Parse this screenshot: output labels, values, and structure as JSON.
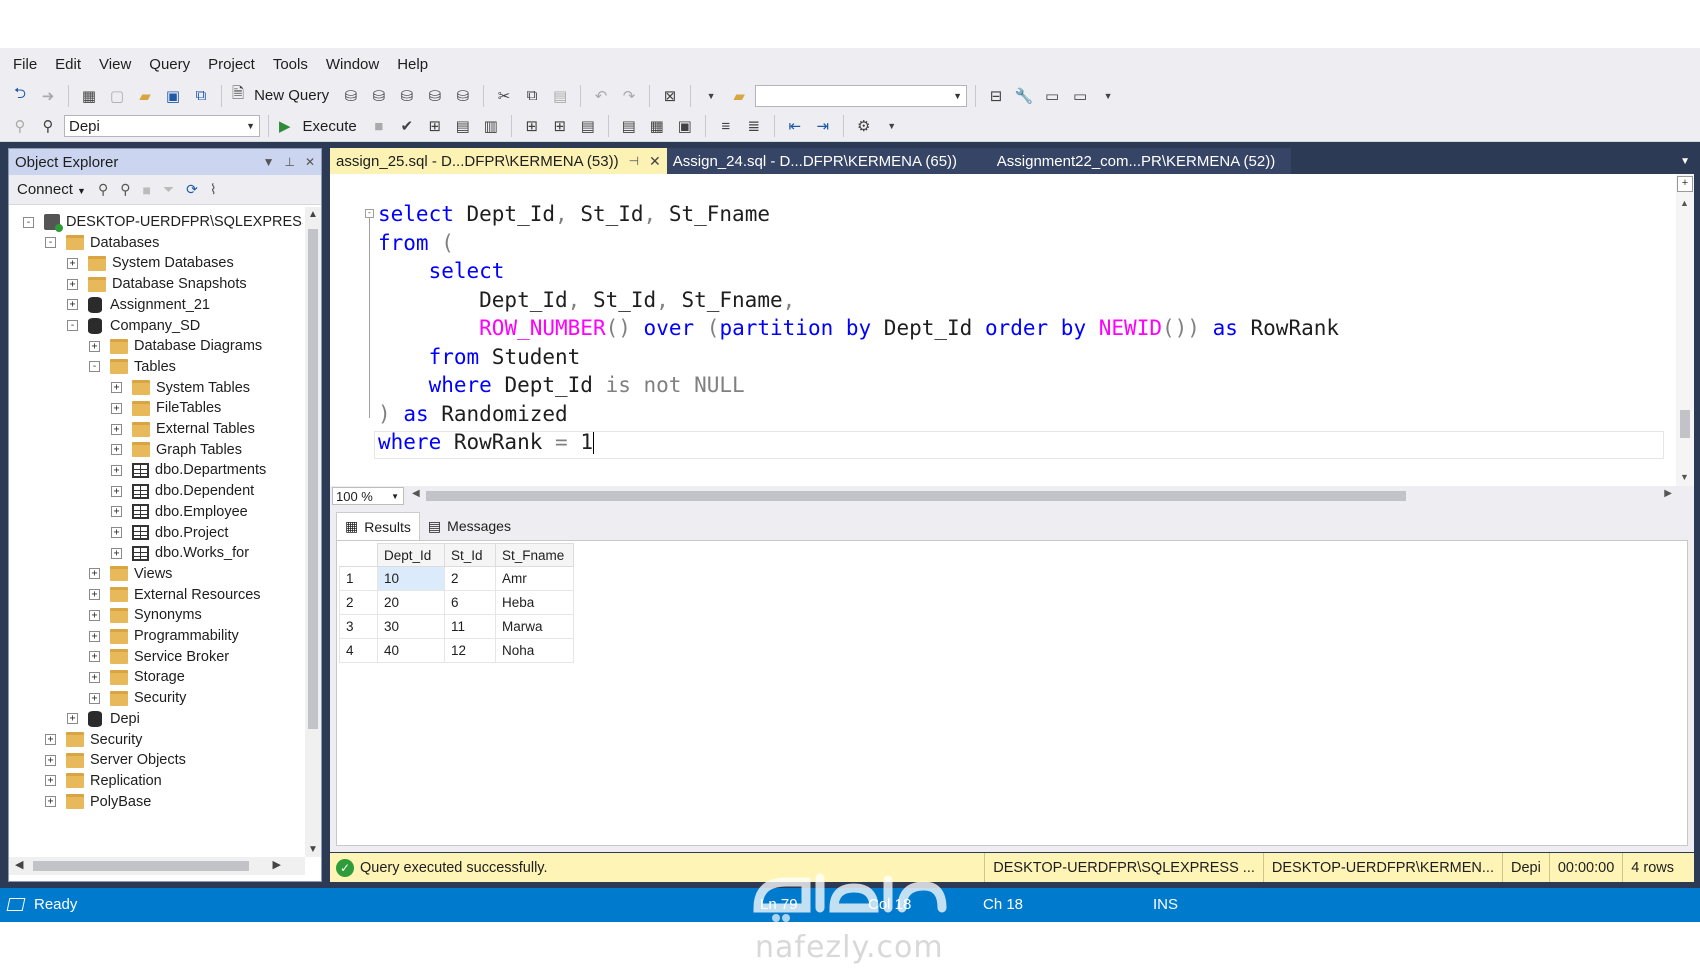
{
  "menu": [
    "File",
    "Edit",
    "View",
    "Query",
    "Project",
    "Tools",
    "Window",
    "Help"
  ],
  "toolbar": {
    "new_query_label": "New Query",
    "execute_label": "Execute",
    "database_combo_value": "Depi"
  },
  "object_explorer": {
    "title": "Object Explorer",
    "connect_label": "Connect",
    "tree": [
      {
        "label": "DESKTOP-UERDFPR\\SQLEXPRESS (S",
        "icon": "server-icon",
        "level": 0,
        "expander": "-"
      },
      {
        "label": "Databases",
        "icon": "folder-icon",
        "level": 1,
        "expander": "-"
      },
      {
        "label": "System Databases",
        "icon": "folder-icon",
        "level": 2,
        "expander": "+"
      },
      {
        "label": "Database Snapshots",
        "icon": "folder-icon",
        "level": 2,
        "expander": "+"
      },
      {
        "label": "Assignment_21",
        "icon": "database-icon",
        "level": 2,
        "expander": "+"
      },
      {
        "label": "Company_SD",
        "icon": "database-icon",
        "level": 2,
        "expander": "-"
      },
      {
        "label": "Database Diagrams",
        "icon": "folder-icon",
        "level": 3,
        "expander": "+"
      },
      {
        "label": "Tables",
        "icon": "folder-icon",
        "level": 3,
        "expander": "-"
      },
      {
        "label": "System Tables",
        "icon": "folder-icon",
        "level": 4,
        "expander": "+"
      },
      {
        "label": "FileTables",
        "icon": "folder-icon",
        "level": 4,
        "expander": "+"
      },
      {
        "label": "External Tables",
        "icon": "folder-icon",
        "level": 4,
        "expander": "+"
      },
      {
        "label": "Graph Tables",
        "icon": "folder-icon",
        "level": 4,
        "expander": "+"
      },
      {
        "label": "dbo.Departments",
        "icon": "table-icon",
        "level": 4,
        "expander": "+"
      },
      {
        "label": "dbo.Dependent",
        "icon": "table-icon",
        "level": 4,
        "expander": "+"
      },
      {
        "label": "dbo.Employee",
        "icon": "table-icon",
        "level": 4,
        "expander": "+"
      },
      {
        "label": "dbo.Project",
        "icon": "table-icon",
        "level": 4,
        "expander": "+"
      },
      {
        "label": "dbo.Works_for",
        "icon": "table-icon",
        "level": 4,
        "expander": "+"
      },
      {
        "label": "Views",
        "icon": "folder-icon",
        "level": 3,
        "expander": "+"
      },
      {
        "label": "External Resources",
        "icon": "folder-icon",
        "level": 3,
        "expander": "+"
      },
      {
        "label": "Synonyms",
        "icon": "folder-icon",
        "level": 3,
        "expander": "+"
      },
      {
        "label": "Programmability",
        "icon": "folder-icon",
        "level": 3,
        "expander": "+"
      },
      {
        "label": "Service Broker",
        "icon": "folder-icon",
        "level": 3,
        "expander": "+"
      },
      {
        "label": "Storage",
        "icon": "folder-icon",
        "level": 3,
        "expander": "+"
      },
      {
        "label": "Security",
        "icon": "folder-icon",
        "level": 3,
        "expander": "+"
      },
      {
        "label": "Depi",
        "icon": "database-icon",
        "level": 2,
        "expander": "+"
      },
      {
        "label": "Security",
        "icon": "folder-icon",
        "level": 1,
        "expander": "+"
      },
      {
        "label": "Server Objects",
        "icon": "folder-icon",
        "level": 1,
        "expander": "+"
      },
      {
        "label": "Replication",
        "icon": "folder-icon",
        "level": 1,
        "expander": "+"
      },
      {
        "label": "PolyBase",
        "icon": "folder-icon",
        "level": 1,
        "expander": "+"
      }
    ]
  },
  "tabs": [
    {
      "label": "assign_25.sql - D...DFPR\\KERMENA (53))",
      "active": true
    },
    {
      "label": "Assign_24.sql - D...DFPR\\KERMENA (65))",
      "active": false
    },
    {
      "label": "Assignment22_com...PR\\KERMENA (52))",
      "active": false
    }
  ],
  "editor": {
    "lines": [
      [
        [
          "kw",
          "select"
        ],
        [
          "t",
          " Dept_Id"
        ],
        [
          "op",
          ","
        ],
        [
          "t",
          " St_Id"
        ],
        [
          "op",
          ","
        ],
        [
          "t",
          " St_Fname"
        ]
      ],
      [
        [
          "kw",
          "from"
        ],
        [
          "t",
          " "
        ],
        [
          "op",
          "("
        ]
      ],
      [
        [
          "t",
          "    "
        ],
        [
          "kw",
          "select"
        ]
      ],
      [
        [
          "t",
          "        Dept_Id"
        ],
        [
          "op",
          ","
        ],
        [
          "t",
          " St_Id"
        ],
        [
          "op",
          ","
        ],
        [
          "t",
          " St_Fname"
        ],
        [
          "op",
          ","
        ]
      ],
      [
        [
          "t",
          "        "
        ],
        [
          "fn",
          "ROW_NUMBER"
        ],
        [
          "op",
          "()"
        ],
        [
          "t",
          " "
        ],
        [
          "kw",
          "over"
        ],
        [
          "t",
          " "
        ],
        [
          "op",
          "("
        ],
        [
          "kw",
          "partition by"
        ],
        [
          "t",
          " Dept_Id "
        ],
        [
          "kw",
          "order by"
        ],
        [
          "t",
          " "
        ],
        [
          "fn",
          "NEWID"
        ],
        [
          "op",
          "())"
        ],
        [
          "t",
          " "
        ],
        [
          "kw",
          "as"
        ],
        [
          "t",
          " RowRank"
        ]
      ],
      [
        [
          "t",
          "    "
        ],
        [
          "kw",
          "from"
        ],
        [
          "t",
          " Student"
        ]
      ],
      [
        [
          "t",
          "    "
        ],
        [
          "kw",
          "where"
        ],
        [
          "t",
          " Dept_Id "
        ],
        [
          "op",
          "is not NULL"
        ]
      ],
      [
        [
          "op",
          ")"
        ],
        [
          "t",
          " "
        ],
        [
          "kw",
          "as"
        ],
        [
          "t",
          " Randomized"
        ]
      ],
      [
        [
          "kw",
          "where"
        ],
        [
          "t",
          " RowRank "
        ],
        [
          "op",
          "="
        ],
        [
          "t",
          " 1"
        ]
      ]
    ],
    "zoom": "100 %"
  },
  "results": {
    "tabs": [
      "Results",
      "Messages"
    ],
    "columns": [
      "Dept_Id",
      "St_Id",
      "St_Fname"
    ],
    "rows": [
      [
        "1",
        "10",
        "2",
        "Amr"
      ],
      [
        "2",
        "20",
        "6",
        "Heba"
      ],
      [
        "3",
        "30",
        "11",
        "Marwa"
      ],
      [
        "4",
        "40",
        "12",
        "Noha"
      ]
    ]
  },
  "query_status": {
    "message": "Query executed successfully.",
    "server": "DESKTOP-UERDFPR\\SQLEXPRESS ...",
    "user": "DESKTOP-UERDFPR\\KERMEN...",
    "database": "Depi",
    "elapsed": "00:00:00",
    "rows": "4 rows"
  },
  "statusbar": {
    "ready": "Ready",
    "ln": "Ln 79",
    "col": "Col 18",
    "ch": "Ch 18",
    "mode": "INS"
  },
  "watermark": "nafezly.com",
  "colors": {
    "frame": "#2d3a56",
    "active_tab": "#fcf2b4",
    "status_bar": "#007acc",
    "keyword": "#0000ff",
    "function": "#ff00ff",
    "operator": "#808080"
  }
}
